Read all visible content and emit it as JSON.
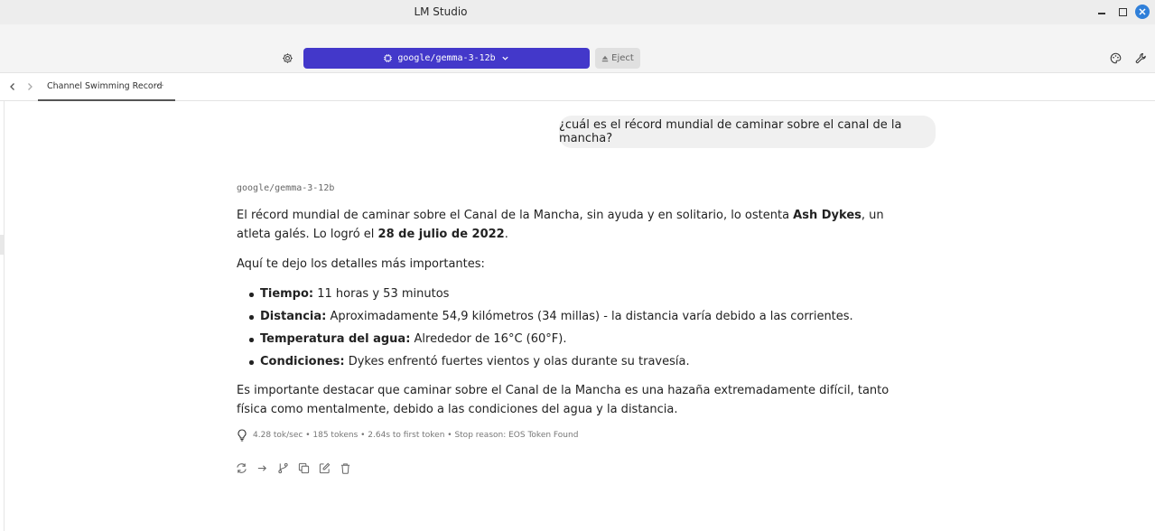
{
  "window": {
    "title": "LM Studio"
  },
  "toolbar": {
    "model_name": "google/gemma-3-12b",
    "eject_label": "Eject",
    "model_select_color": "#4338ca",
    "icons": [
      "settings-gear-icon",
      "cpu-chip-icon",
      "chevron-down-icon",
      "eject-icon",
      "theme-palette-icon",
      "wrench-icon"
    ]
  },
  "tabs": {
    "items": [
      {
        "label": "Channel Swimming Record",
        "active": true
      }
    ],
    "more_label": "···"
  },
  "chat": {
    "user_message": "¿cuál es el récord mundial de caminar sobre el canal de la mancha?",
    "assistant": {
      "model_label": "google/gemma-3-12b",
      "p1": {
        "t1": "El récord mundial de caminar sobre el Canal de la Mancha, sin ayuda y en solitario, lo ostenta ",
        "b1": "Ash Dykes",
        "t2": ", un atleta galés. Lo logró el ",
        "b2": "28 de julio de 2022",
        "t3": "."
      },
      "p2": "Aquí te dejo los detalles más importantes:",
      "bullets": [
        {
          "label": "Tiempo:",
          "text": " 11 horas y 53 minutos"
        },
        {
          "label": "Distancia:",
          "text": " Aproximadamente 54,9 kilómetros (34 millas) - la distancia varía debido a las corrientes."
        },
        {
          "label": "Temperatura del agua:",
          "text": " Alrededor de 16°C (60°F)."
        },
        {
          "label": "Condiciones:",
          "text": " Dykes enfrentó fuertes vientos y olas durante su travesía."
        }
      ],
      "p3": "Es importante destacar que caminar sobre el Canal de la Mancha es una hazaña extremadamente difícil, tanto física como mentalmente, debido a las condiciones del agua y la distancia.",
      "stats": "4.28 tok/sec • 185 tokens • 2.64s to first token • Stop reason: EOS Token Found",
      "actions": [
        "regenerate-icon",
        "continue-arrow-icon",
        "branch-icon",
        "copy-icon",
        "edit-icon",
        "delete-trash-icon"
      ]
    }
  }
}
